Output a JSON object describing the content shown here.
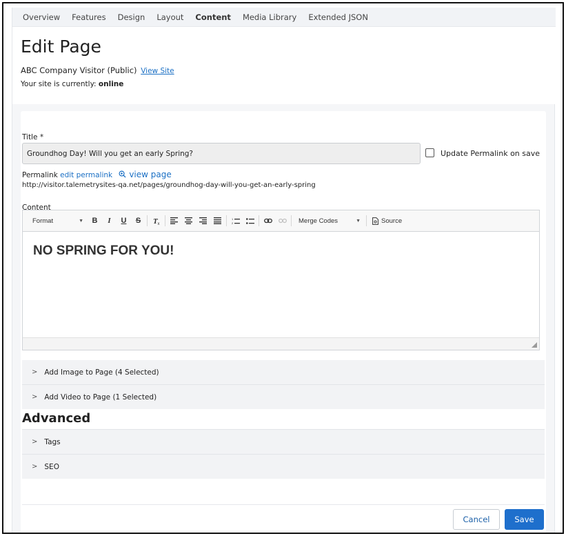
{
  "nav": {
    "tabs": [
      {
        "label": "Overview"
      },
      {
        "label": "Features"
      },
      {
        "label": "Design"
      },
      {
        "label": "Layout"
      },
      {
        "label": "Content",
        "active": true
      },
      {
        "label": "Media Library"
      },
      {
        "label": "Extended JSON"
      }
    ]
  },
  "header": {
    "title": "Edit Page",
    "site_name": "ABC Company Visitor (Public)",
    "view_site": "View Site",
    "status_prefix": "Your site is currently:",
    "status_value": "online"
  },
  "form": {
    "title_label": "Title *",
    "title_value": "Groundhog Day! Will you get an early Spring?",
    "update_permalink_label": "Update Permalink on save",
    "update_permalink_checked": false,
    "permalink_label": "Permalink",
    "edit_permalink": "edit permalink",
    "view_page": "view page",
    "permalink_url": "http://visitor.talemetrysites-qa.net/pages/groundhog-day-will-you-get-an-early-spring",
    "content_label": "Content"
  },
  "editor": {
    "format_label": "Format",
    "merge_codes_label": "Merge Codes",
    "source_label": "Source",
    "content_heading": "NO SPRING FOR YOU!"
  },
  "sections": {
    "add_image": "Add Image to Page (4 Selected)",
    "add_video": "Add Video to Page (1 Selected)",
    "advanced_heading": "Advanced",
    "tags": "Tags",
    "seo": "SEO"
  },
  "actions": {
    "cancel": "Cancel",
    "save": "Save"
  },
  "colors": {
    "link": "#1a6fc4",
    "primary_button": "#1e6fcc"
  }
}
